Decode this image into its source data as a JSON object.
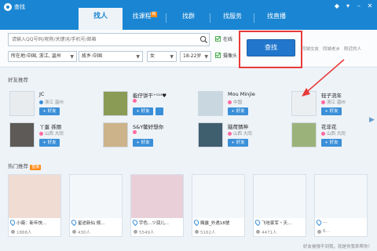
{
  "window": {
    "title": "查找"
  },
  "tabs": [
    {
      "label": "找人",
      "active": true
    },
    {
      "label": "找课程",
      "badge": "新"
    },
    {
      "label": "找群"
    },
    {
      "label": "找服务"
    },
    {
      "label": "找直播"
    }
  ],
  "search": {
    "placeholder": "请输入QQ号码/昵称/关键词/手机号/邮箱",
    "online_label": "在线",
    "camera_label": "摄像头",
    "location": "所在地:中国, 浙江, 温州",
    "hometown": "故乡:中国",
    "gender": "女",
    "age": "18-22岁",
    "find_button": "查找",
    "hint_1": "同城交友",
    "hint_2": "同城老乡",
    "hint_3": "附近的人"
  },
  "friends_section": {
    "title": "好友推荐"
  },
  "friends": [
    {
      "name": "JC",
      "location": "浙江 温州",
      "gender": "male"
    },
    {
      "name": "能仔饼干⁺⁰¹⁴♥",
      "location": "",
      "gender": "female"
    },
    {
      "name": "Mou Minjie",
      "location": "中国",
      "gender": "female"
    },
    {
      "name": "轻子流年",
      "location": "浙江 温州",
      "gender": "female"
    },
    {
      "name": "丫蛋 孫丽",
      "location": "山西 大同",
      "gender": "female"
    },
    {
      "name": "S&Y鳖好想你",
      "location": "",
      "gender": "female"
    },
    {
      "name": "脑荷猜神",
      "location": "山西 大同",
      "gender": "female"
    },
    {
      "name": "花非花",
      "location": "山西 大同",
      "gender": "female"
    }
  ],
  "add_label": "+ 好友",
  "hot_section": {
    "title": "热门推荐",
    "badge": "直播"
  },
  "live": [
    {
      "title": "小薇：新年快…",
      "count": "1868人"
    },
    {
      "title": "星途新仙 佩…",
      "count": "430人"
    },
    {
      "title": "宇色...ツ润儿...",
      "count": "5549人"
    },
    {
      "title": "赐露_外遇18號",
      "count": "5162人"
    },
    {
      "title": "飞哇家军丶天…",
      "count": "4471人"
    },
    {
      "title": "…",
      "count": "6…"
    }
  ],
  "status": {
    "text": "好友被搜不到我，就是你我来帮你！"
  },
  "colors": {
    "brand": "#1a86d3",
    "button": "#2277cc",
    "highlight": "#e83a3a"
  }
}
